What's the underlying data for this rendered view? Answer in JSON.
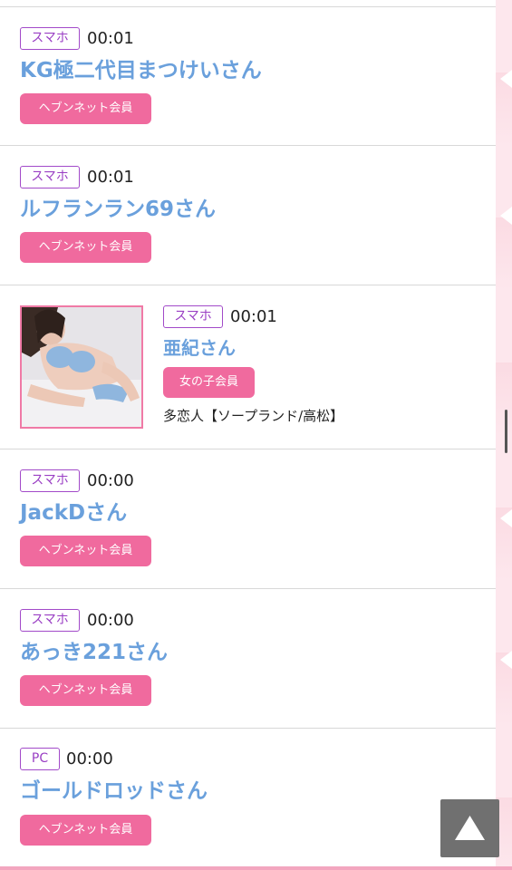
{
  "entries": [
    {
      "device": "スマホ",
      "time": "00:01",
      "name": "KG極二代目まつけいさん",
      "badge": "ヘブンネット会員"
    },
    {
      "device": "スマホ",
      "time": "00:01",
      "name": "ルフランラン69さん",
      "badge": "ヘブンネット会員"
    },
    {
      "device": "スマホ",
      "time": "00:01",
      "name": "亜紀さん",
      "badge": "女の子会員",
      "shop": "多恋人【ソープランド/高松】"
    },
    {
      "device": "スマホ",
      "time": "00:00",
      "name": "JackDさん",
      "badge": "ヘブンネット会員"
    },
    {
      "device": "スマホ",
      "time": "00:00",
      "name": "あっき221さん",
      "badge": "ヘブンネット会員"
    },
    {
      "device": "PC",
      "time": "00:00",
      "name": "ゴールドロッドさん",
      "badge": "ヘブンネット会員"
    }
  ],
  "colors": {
    "name_link": "#6aa0dc",
    "device_border": "#a24ac9",
    "badge_bg": "#f06a9e",
    "side_bar": "#fde9ee"
  },
  "icons": {
    "scroll_top": "triangle-up-icon"
  }
}
